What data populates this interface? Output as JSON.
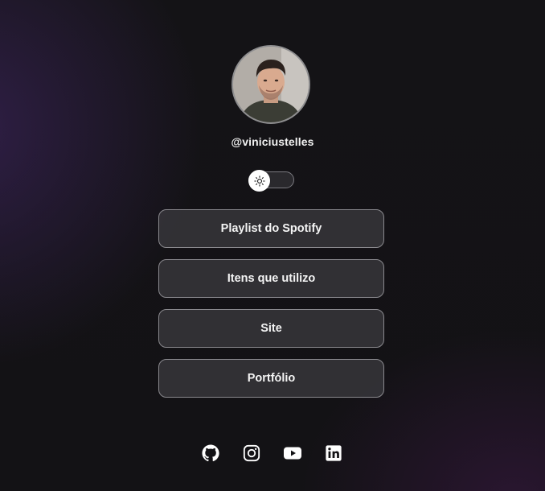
{
  "profile": {
    "username": "@viniciustelles",
    "avatar_alt": "",
    "theme_toggle_icon": "sun-icon"
  },
  "links": [
    {
      "label": "Playlist do Spotify"
    },
    {
      "label": "Itens que utilizo"
    },
    {
      "label": "Site"
    },
    {
      "label": "Portfólio"
    }
  ],
  "socials": [
    {
      "icon": "github-icon"
    },
    {
      "icon": "instagram-icon"
    },
    {
      "icon": "youtube-icon"
    },
    {
      "icon": "linkedin-icon"
    }
  ],
  "colors": {
    "background": "#121114",
    "button_bg": "#3a383e",
    "button_border": "#8a898e",
    "text": "#ffffff"
  }
}
